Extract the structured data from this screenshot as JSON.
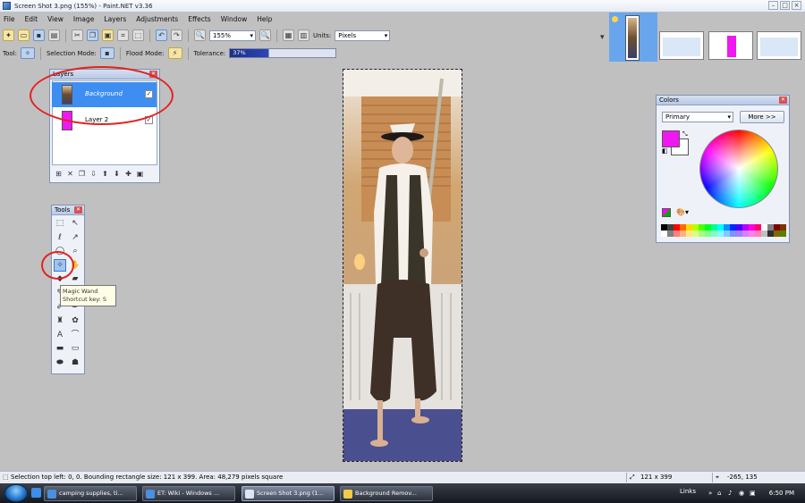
{
  "window": {
    "title": "Screen Shot 3.png (155%) - Paint.NET v3.36"
  },
  "menu": [
    "File",
    "Edit",
    "View",
    "Image",
    "Layers",
    "Adjustments",
    "Effects",
    "Window",
    "Help"
  ],
  "toolbar": {
    "zoom": "155%",
    "units_label": "Units:",
    "units_value": "Pixels",
    "tool_label": "Tool:",
    "selection_mode_label": "Selection Mode:",
    "flood_mode_label": "Flood Mode:",
    "tolerance_label": "Tolerance:",
    "tolerance_value": "37%",
    "tolerance_fraction": 0.37
  },
  "layers_panel": {
    "title": "Layers",
    "layers": [
      {
        "name": "Background",
        "selected": true,
        "visible_check": "✓"
      },
      {
        "name": "Layer 2",
        "selected": false,
        "visible_check": "✓"
      }
    ]
  },
  "tools_panel": {
    "title": "Tools",
    "tooltip_title": "Magic Wand",
    "tooltip_shortcut": "Shortcut key: S"
  },
  "colors_panel": {
    "title": "Colors",
    "mode": "Primary",
    "more_button": "More >>",
    "primary_color": "#f018f0",
    "secondary_color": "#ffffff"
  },
  "status": {
    "message": "Selection top left: 0, 0. Bounding rectangle size: 121 x 399. Area: 48,279 pixels square",
    "image_size": "121 x 399",
    "cursor": "-265, 135"
  },
  "taskbar": {
    "tasks": [
      {
        "label": "camping supplies, ti...",
        "active": false
      },
      {
        "label": "ET: Wiki - Windows ...",
        "active": false
      },
      {
        "label": "Screen Shot 3.png (1...",
        "active": true
      },
      {
        "label": "Background Remov...",
        "active": false
      }
    ],
    "links": "Links",
    "clock": "6:50 PM"
  }
}
